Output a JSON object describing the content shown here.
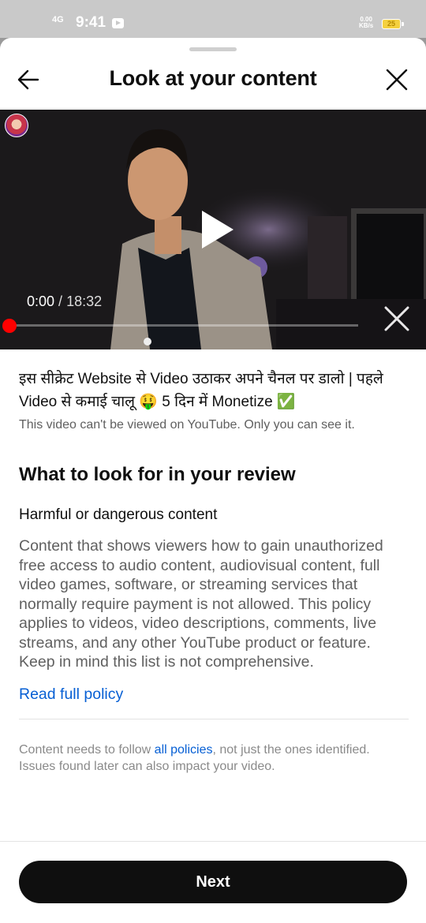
{
  "status_bar": {
    "network": "4G",
    "time": "9:41",
    "speed_top": "0.00",
    "speed_unit": "KB/s",
    "battery": "25"
  },
  "header": {
    "title": "Look at your content",
    "back_icon": "arrow-left-icon",
    "close_icon": "close-icon"
  },
  "video": {
    "current_time": "0:00",
    "separator": " / ",
    "duration": "18:32",
    "progress": 0,
    "play_icon": "play-icon",
    "close_icon": "close-icon"
  },
  "content": {
    "video_title": "इस सीक्रेट Website से Video उठाकर अपने चैनल पर डालो | पहले Video से कमाई चालू 🤑 5 दिन में Monetize ✅",
    "visibility_note": "This video can't be viewed on YouTube. Only you can see it.",
    "review_heading": "What to look for in your review",
    "category": "Harmful or dangerous content",
    "policy_text": "Content that shows viewers how to gain unauthorized free access to audio content, audiovisual content, full video games, software, or streaming services that normally require payment is not allowed. This policy applies to videos, video descriptions, comments, live streams, and any other YouTube product or feature. Keep in mind this list is not comprehensive.",
    "read_policy_link": "Read full policy",
    "footnote_before": "Content needs to follow ",
    "footnote_link": "all policies",
    "footnote_after": ", not just the ones identified. Issues found later can also impact your video."
  },
  "actions": {
    "next_label": "Next"
  },
  "colors": {
    "link": "#065fd4",
    "primary_button": "#0f0f0f",
    "progress": "#ff0000"
  }
}
